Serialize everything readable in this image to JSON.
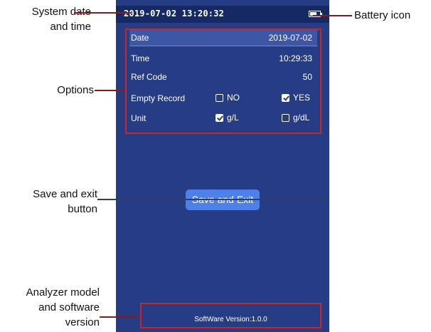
{
  "device": {
    "status_datetime": "2019-07-02  13:20:32",
    "options": [
      {
        "label": "Date",
        "value": "2019-07-02",
        "selected": true
      },
      {
        "label": "Time",
        "value": "10:29:33"
      },
      {
        "label": "Ref Code",
        "value": "50"
      }
    ],
    "empty_record": {
      "label": "Empty Record",
      "choices": [
        {
          "label": "NO",
          "checked": false
        },
        {
          "label": "YES",
          "checked": true
        }
      ]
    },
    "unit": {
      "label": "Unit",
      "choices": [
        {
          "label": "g/L",
          "checked": true
        },
        {
          "label": "g/dL",
          "checked": false
        }
      ]
    },
    "save_button": "Save and Exit",
    "software_version": "SoftWare Version:1.0.0"
  },
  "callouts": {
    "datetime": [
      "System date",
      "and time"
    ],
    "battery": "Battery icon",
    "options": "Options",
    "save": [
      "Save and exit",
      "button"
    ],
    "version": [
      "Analyzer model",
      "and software",
      "version"
    ]
  },
  "colors": {
    "screen_bg": "#263c85",
    "status_bar": "#152a64",
    "highlight_box": "#c62828",
    "button": "#4d80e8"
  }
}
